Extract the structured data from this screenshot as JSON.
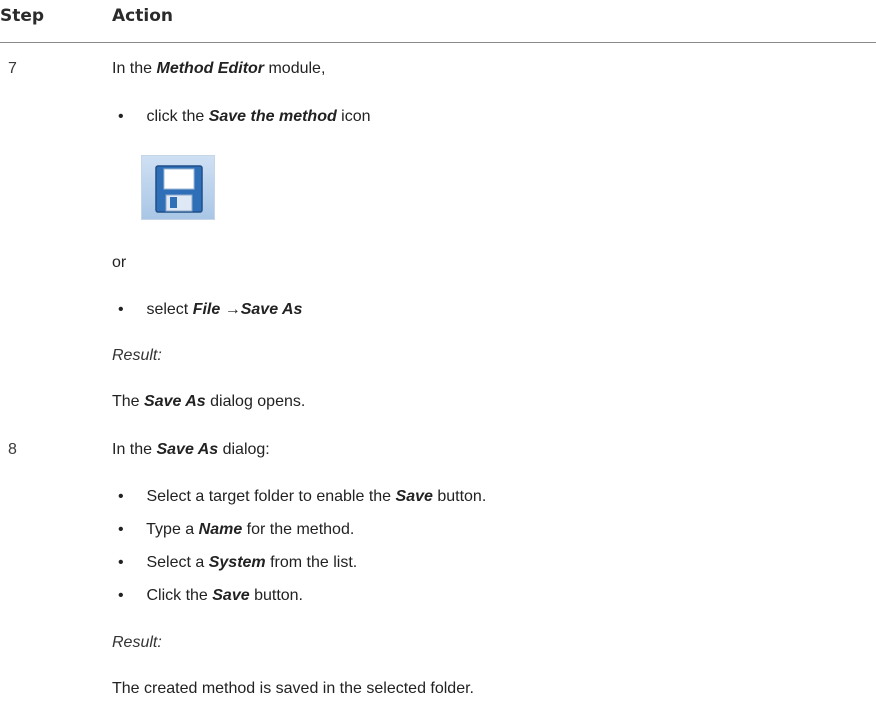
{
  "header": {
    "step": "Step",
    "action": "Action"
  },
  "steps": [
    {
      "number": "7",
      "intro": [
        "In the ",
        "Method Editor",
        " module,"
      ],
      "bullet1": [
        "click the ",
        "Save the method",
        " icon"
      ],
      "icon": "save-disk-icon",
      "or_text": "or",
      "bullet2": [
        "select ",
        "File",
        " →",
        "Save As"
      ],
      "result_label": "Result:",
      "result_text": [
        "The ",
        "Save As",
        " dialog opens."
      ]
    },
    {
      "number": "8",
      "intro": [
        "In the ",
        "Save As",
        " dialog:"
      ],
      "bullets": [
        [
          "Select a target folder to enable the ",
          "Save",
          " button."
        ],
        [
          "Type a ",
          "Name",
          " for the method."
        ],
        [
          "Select a ",
          "System",
          " from the list."
        ],
        [
          "Click the ",
          "Save",
          " button."
        ]
      ],
      "result_label": "Result:",
      "result_text": "The created method is saved in the selected folder."
    }
  ]
}
